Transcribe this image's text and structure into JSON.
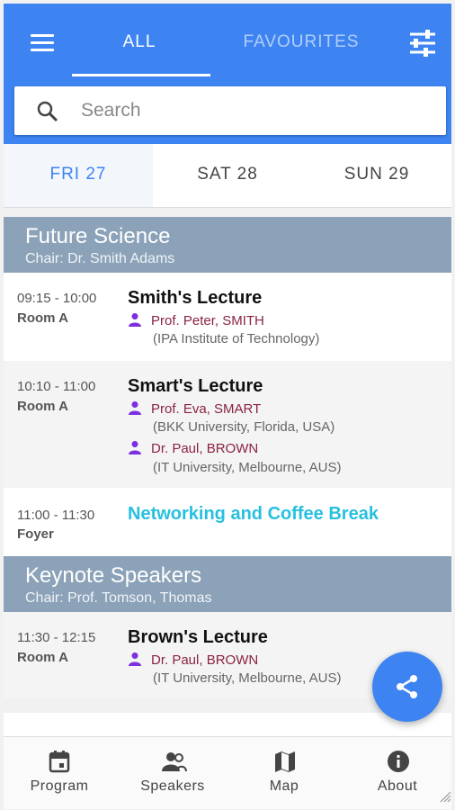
{
  "top_tabs": {
    "all_label": "ALL",
    "favourites_label": "FAVOURITES"
  },
  "search": {
    "placeholder": "Search",
    "value": ""
  },
  "days": [
    {
      "label": "FRI 27",
      "active": true
    },
    {
      "label": "SAT 28"
    },
    {
      "label": "SUN 29"
    }
  ],
  "sessions": [
    {
      "title": "Future Science",
      "chair": "Chair: Dr. Smith Adams",
      "items": [
        {
          "time": "09:15 - 10:00",
          "room": "Room A",
          "title": "Smith's Lecture",
          "speakers": [
            {
              "name": "Prof. Peter, SMITH",
              "affiliation": "(IPA Institute of Technology)"
            }
          ]
        },
        {
          "time": "10:10 - 11:00",
          "room": "Room A",
          "title": "Smart's Lecture",
          "speakers": [
            {
              "name": "Prof. Eva, SMART",
              "affiliation": "(BKK University, Florida, USA)"
            },
            {
              "name": "Dr. Paul, BROWN",
              "affiliation": "(IT University, Melbourne, AUS)"
            }
          ]
        },
        {
          "time": "11:00 - 11:30",
          "room": "Foyer",
          "title": "Networking and Coffee Break"
        }
      ]
    },
    {
      "title": "Keynote Speakers",
      "chair": "Chair: Prof. Tomson, Thomas",
      "items": [
        {
          "time": "11:30 - 12:15",
          "room": "Room A",
          "title": "Brown's Lecture",
          "speakers": [
            {
              "name": "Dr. Paul, BROWN",
              "affiliation": "(IT University, Melbourne, AUS)"
            }
          ]
        }
      ]
    }
  ],
  "bottom_nav": [
    {
      "label": "Program"
    },
    {
      "label": "Speakers"
    },
    {
      "label": "Map"
    },
    {
      "label": "About"
    }
  ],
  "colors": {
    "primary": "#3d84f2",
    "session_header": "#8ba2b8",
    "break_title": "#27c0e0",
    "speaker_name": "#8a2340",
    "person_icon": "#7b2fe0"
  },
  "icons": {
    "menu": "menu-icon",
    "filter": "sliders-icon",
    "search": "search-icon",
    "person": "person-icon",
    "share": "share-icon",
    "program": "calendar-icon",
    "speakers": "people-icon",
    "map": "map-icon",
    "about": "info-icon"
  }
}
